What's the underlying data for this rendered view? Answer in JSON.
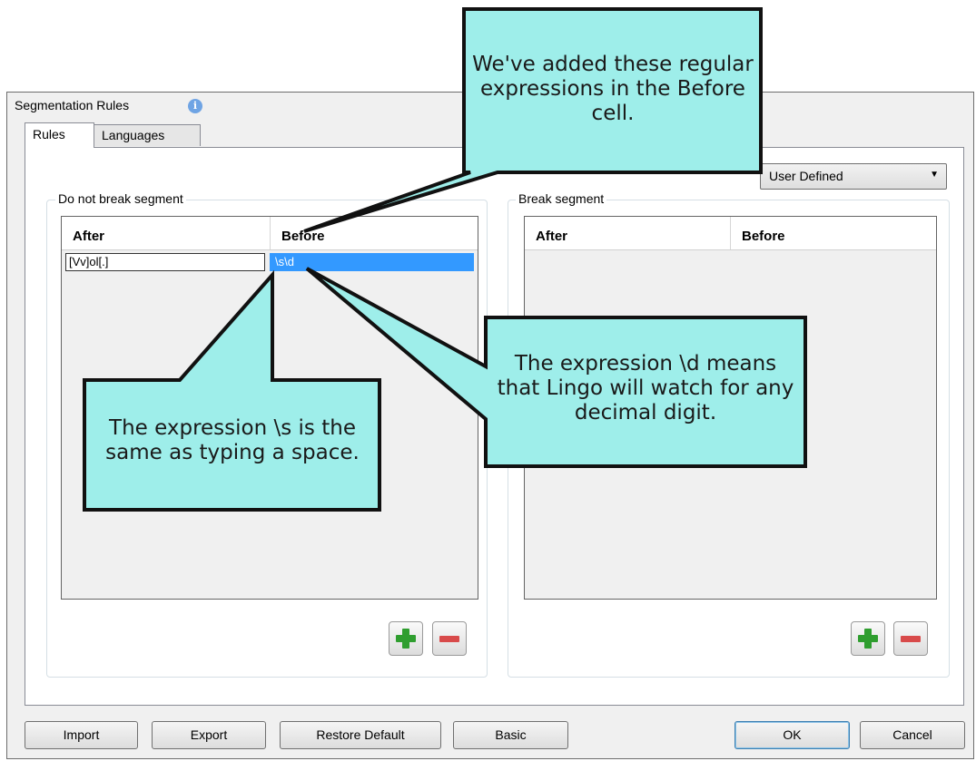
{
  "dialog": {
    "title": "Segmentation Rules",
    "info_icon": "i"
  },
  "tabs": [
    {
      "label": "Rules",
      "active": true
    },
    {
      "label": "Languages",
      "active": false
    }
  ],
  "mode_select": {
    "value": "User Defined",
    "arrow": "▼"
  },
  "do_not_break": {
    "label": "Do not break segment",
    "columns": [
      "After",
      "Before"
    ],
    "rows": [
      {
        "after": "[Vv]ol[.]",
        "before": "\\s\\d"
      }
    ]
  },
  "break_segment": {
    "label": "Break segment",
    "columns": [
      "After",
      "Before"
    ],
    "rows": []
  },
  "buttons": {
    "import": "Import",
    "export": "Export",
    "restore_default": "Restore Default",
    "basic": "Basic",
    "ok": "OK",
    "cancel": "Cancel"
  },
  "callouts": {
    "before_cell": "We've added these regular expressions in the Before cell.",
    "space": "The expression \\s is the same as typing a space.",
    "digit": "The expression \\d means that Lingo will watch for any decimal digit."
  },
  "colors": {
    "callout_fill": "#9eeeea",
    "selection": "#3399ff",
    "add_green": "#2f9e2f",
    "remove_red": "#d84a4a"
  }
}
